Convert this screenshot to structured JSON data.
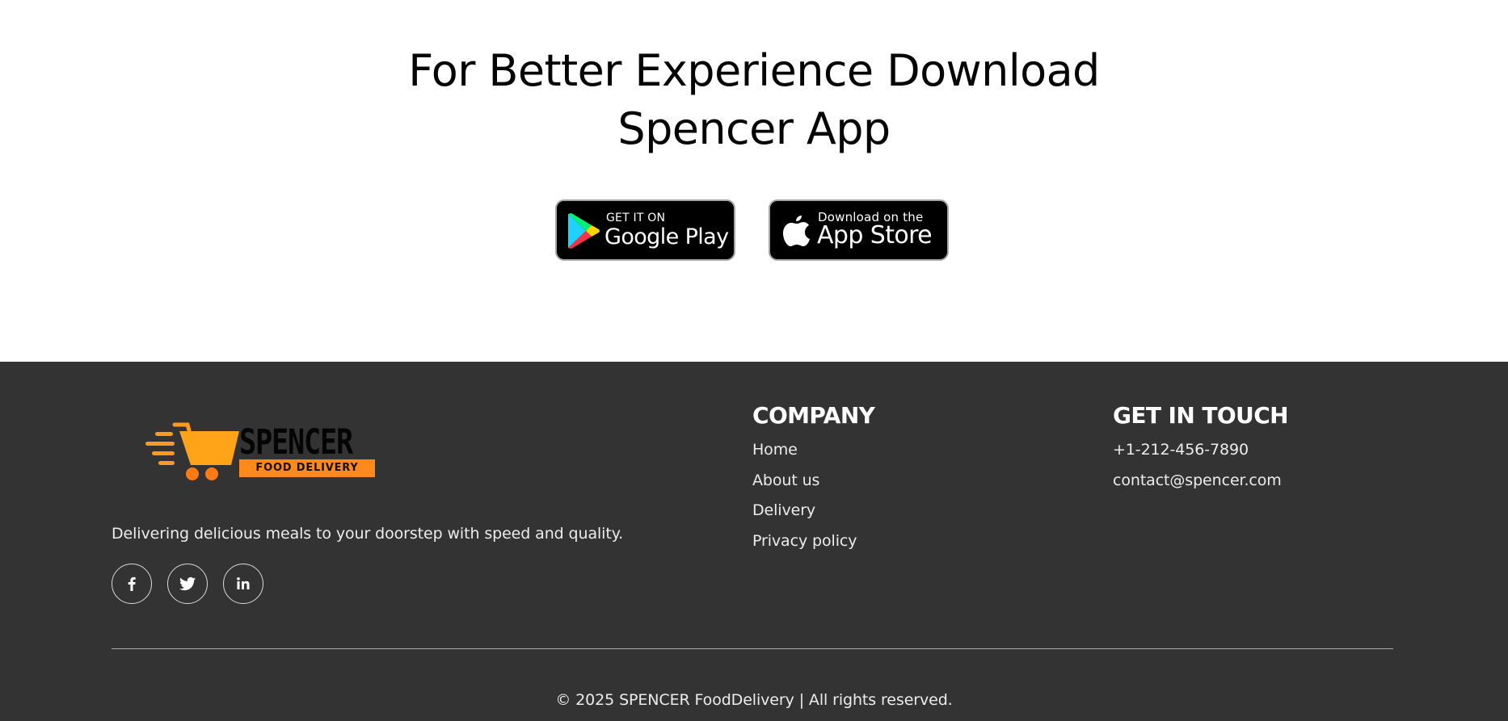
{
  "download": {
    "heading_line1": "For Better Experience Download",
    "heading_line2": "Spencer App",
    "google_play": {
      "small": "GET IT ON",
      "big": "Google Play",
      "icon": "google-play-icon"
    },
    "app_store": {
      "small": "Download on the",
      "big": "App Store",
      "icon": "apple-icon"
    }
  },
  "footer": {
    "logo": {
      "word": "SPENCER",
      "tag": "FOOD DELIVERY",
      "icon": "delivery-cart-icon"
    },
    "tagline": "Delivering delicious meals to your doorstep with speed and quality.",
    "social": [
      {
        "name": "facebook-icon",
        "glyph": "f"
      },
      {
        "name": "twitter-icon",
        "glyph": "twitter"
      },
      {
        "name": "linkedin-icon",
        "glyph": "in"
      }
    ],
    "company": {
      "heading": "COMPANY",
      "links": [
        "Home",
        "About us",
        "Delivery",
        "Privacy policy"
      ]
    },
    "contact": {
      "heading": "GET IN TOUCH",
      "phone": "+1-212-456-7890",
      "email": "contact@spencer.com"
    },
    "copyright": "© 2025 SPENCER FoodDelivery | All rights reserved."
  },
  "colors": {
    "footer_bg": "#333333",
    "brand_orange": "#ff8a1b",
    "badge_bg": "#000000"
  }
}
